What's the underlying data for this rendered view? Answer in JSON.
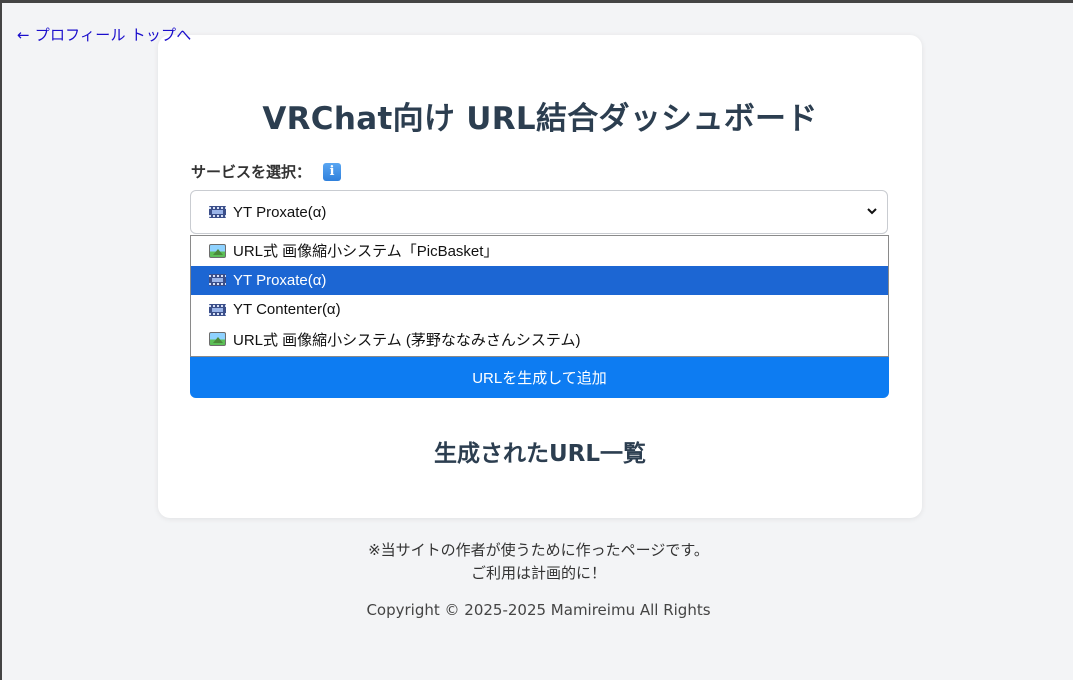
{
  "nav": {
    "back_arrow": "←",
    "back_label": "プロフィール トップへ"
  },
  "card": {
    "title": "VRChat向け URL結合ダッシュボード",
    "select_label": "サービスを選択：",
    "info_icon_glyph": "i",
    "selected_value": "YT Proxate(α)",
    "selected_icon": "film-frames-icon",
    "options": [
      {
        "label": "URL式 画像縮小システム「PicBasket」",
        "icon": "framed-picture-icon",
        "selected": false
      },
      {
        "label": "YT Proxate(α)",
        "icon": "film-frames-icon",
        "selected": true
      },
      {
        "label": "YT Contenter(α)",
        "icon": "film-frames-icon",
        "selected": false
      },
      {
        "label": "URL式 画像縮小システム (茅野ななみさんシステム)",
        "icon": "framed-picture-icon",
        "selected": false
      }
    ],
    "generate_button": "URLを生成して追加",
    "list_title": "生成されたURL一覧"
  },
  "footer": {
    "note_line1": "※当サイトの作者が使うために作ったページです。",
    "note_line2": "ご利用は計画的に！",
    "copyright": "Copyright © 2025-2025 Mamireimu All Rights"
  },
  "colors": {
    "page_bg": "#f3f4f6",
    "card_bg": "#ffffff",
    "title_color": "#2c3e50",
    "link_color": "#1a0dcc",
    "button_bg": "#0d7cf2",
    "selected_option_bg": "#1c66d3"
  }
}
